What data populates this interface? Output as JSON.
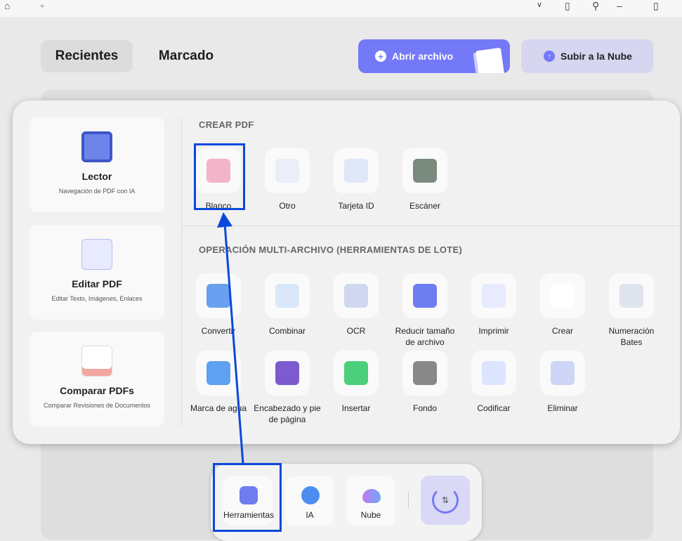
{
  "topbar": {
    "icons": [
      "home-icon",
      "plus-icon",
      "chevron-down-icon",
      "bell-icon",
      "user-icon",
      "minimize-icon",
      "maximize-icon"
    ]
  },
  "tabs": {
    "recent": "Recientes",
    "marked": "Marcado"
  },
  "actions": {
    "open": "Abrir archivo",
    "upload": "Subir a la Nube"
  },
  "left_cards": [
    {
      "title": "Lector",
      "subtitle": "Navegación de PDF con IA"
    },
    {
      "title": "Editar PDF",
      "subtitle": "Editar Texto, Imágenes, Enlaces"
    },
    {
      "title": "Comparar PDFs",
      "subtitle": "Comparar Revisiones de Documentos"
    }
  ],
  "create": {
    "title": "CREAR PDF",
    "items": [
      "Blanco",
      "Otro",
      "Tarjeta ID",
      "Escáner"
    ]
  },
  "batch": {
    "title": "OPERACIÓN MULTI-ARCHIVO (HERRAMIENTAS DE LOTE)",
    "items": [
      "Convertir",
      "Combinar",
      "OCR",
      "Reducir tamaño de archivo",
      "Imprimir",
      "Crear",
      "Numeración Bates",
      "Marca de agua",
      "Encabezado y pie de página",
      "Insertar",
      "Fondo",
      "Codificar",
      "Eliminar"
    ]
  },
  "bottom": {
    "tools": "Herramientas",
    "ai": "IA",
    "cloud": "Nube"
  },
  "colors": {
    "accent": "#7479f8",
    "highlight": "#0a48dc"
  }
}
